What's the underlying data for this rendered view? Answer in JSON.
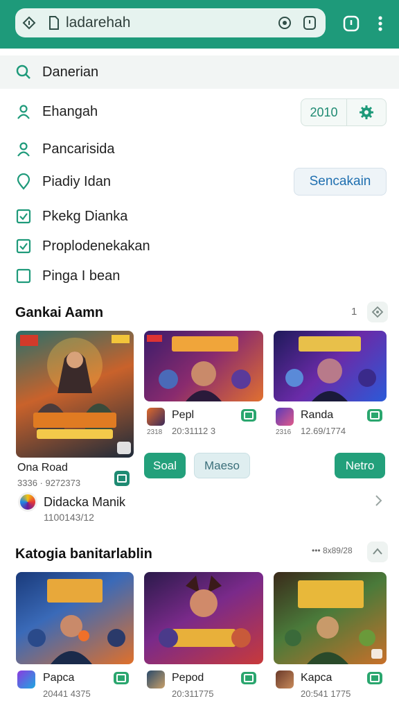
{
  "browser": {
    "url": "ladarehah"
  },
  "search": {
    "label": "Danerian"
  },
  "filters": [
    {
      "label": "Ehangah",
      "icon": "person-icon"
    },
    {
      "label": "Pancarisida",
      "icon": "person-icon"
    },
    {
      "label": "Piadiy Idan",
      "icon": "location-pin-icon"
    },
    {
      "label": "Pkekg Dianka",
      "icon": "checkbox-checked-icon"
    },
    {
      "label": "Proplodenekakan",
      "icon": "checkbox-checked-icon"
    },
    {
      "label": "Pinga I bean",
      "icon": "checkbox-empty-icon"
    }
  ],
  "year_chip": {
    "value": "2010"
  },
  "search_button": {
    "label": "Sencakain"
  },
  "section1": {
    "title": "Gankai Aamn",
    "count": "1",
    "featured": {
      "name": "Ona Road",
      "num": "3336 · 9272373"
    },
    "cards": [
      {
        "name": "Pepl",
        "num": "20:31112 3",
        "small": "2318"
      },
      {
        "name": "Randa",
        "num": "12.69/1774",
        "small": "2316"
      }
    ],
    "buttons": {
      "b1": "Soal",
      "b2": "Maeso",
      "b3": "Netro"
    },
    "dev": {
      "name": "Didacka Manik",
      "num": "1100143/12"
    }
  },
  "section2": {
    "title": "Katogia banitarlablin",
    "more": "••• 8x89/28",
    "cards": [
      {
        "name": "Papca",
        "num": "20441 4375"
      },
      {
        "name": "Pepod",
        "num": "20:311775"
      },
      {
        "name": "Kapca",
        "num": "20:541 1775"
      }
    ]
  },
  "colors": {
    "accent": "#1e9a7a",
    "button_green": "#23a07b",
    "link_blue": "#1f6fb0"
  }
}
